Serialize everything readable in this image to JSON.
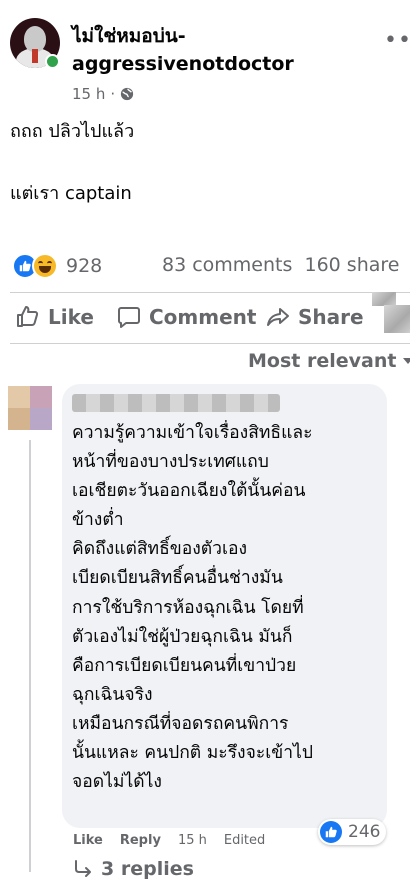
{
  "post": {
    "author": "ไม่ใช่หมอบ่น-aggressivenotdoctor",
    "time": "15 h",
    "separator": "·",
    "text_line1": "ถถถ ปลิวไปแล้ว",
    "text_line2": "แต่เรา captain",
    "reactions_count": "928",
    "comments_count": "83 comments",
    "shares_count": "160 share"
  },
  "actions": {
    "like": "Like",
    "comment": "Comment",
    "share": "Share"
  },
  "sort": {
    "label": "Most relevant"
  },
  "comment": {
    "text": "ความรู้ความเข้าใจเรื่องสิทธิและ\nหน้าที่ของบางประเทศแถบ\nเอเชียตะวันออกเฉียงใต้นั้นค่อน\nข้างต่ำ\nคิดถึงแต่สิทธิ์ของตัวเอง\nเบียดเบียนสิทธิ์คนอื่นช่างมัน\nการใช้บริการห้องฉุกเฉิน โดยที่\nตัวเองไม่ใช่ผู้ป่วยฉุกเฉิน มันก็\nคือการเบียดเบียนคนที่เขาป่วย\nฉุกเฉินจริง\nเหมือนกรณีที่จอดรถคนพิการ\nนั้นแหละ คนปกติ มะรึงจะเข้าไป\nจอดไม่ได้ไง",
    "like_label": "Like",
    "reply_label": "Reply",
    "time": "15 h",
    "edited": "Edited",
    "likes": "246",
    "replies": "3 replies"
  },
  "colors": {
    "brand_blue": "#1877f2",
    "secondary_text": "#65676b",
    "bubble_bg": "#f0f2f5",
    "online_green": "#31a24c"
  }
}
